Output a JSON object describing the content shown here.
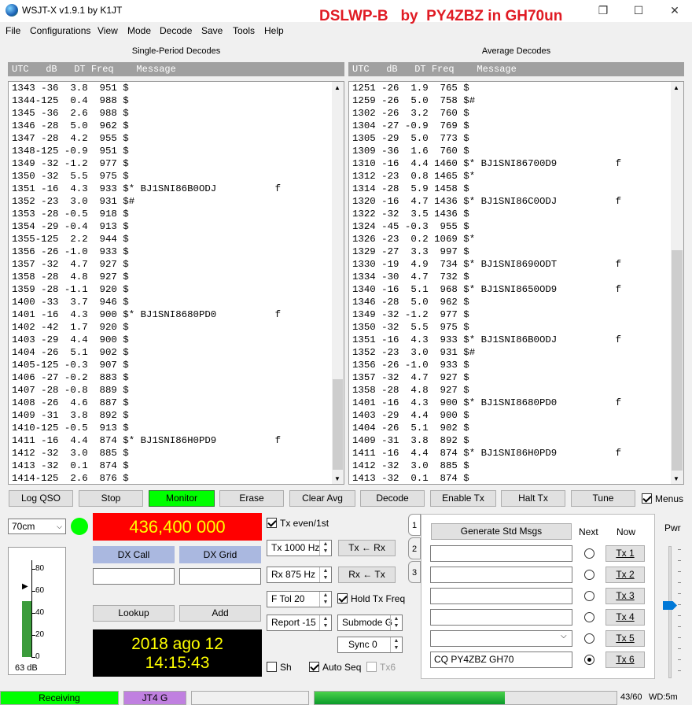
{
  "window": {
    "title": "WSJT-X   v1.9.1   by K1JT",
    "overlay": "DSLWP-B   by  PY4ZBZ in GH70un",
    "min_icon": "minimize-icon",
    "restore_icon": "restore-icon",
    "close_icon": "close-icon"
  },
  "menu": [
    "File",
    "Configurations",
    "View",
    "Mode",
    "Decode",
    "Save",
    "Tools",
    "Help"
  ],
  "left_panel": {
    "caption": "Single-Period Decodes",
    "header": "UTC   dB   DT Freq    Message",
    "lines": [
      "1343 -36  3.8  951 $",
      "1344-125  0.4  988 $",
      "1345 -36  2.6  988 $",
      "1346 -28  5.0  962 $",
      "1347 -28  4.2  955 $",
      "1348-125 -0.9  951 $",
      "1349 -32 -1.2  977 $",
      "1350 -32  5.5  975 $",
      "1351 -16  4.3  933 $* BJ1SNI86B0ODJ          f",
      "1352 -23  3.0  931 $#",
      "1353 -28 -0.5  918 $",
      "1354 -29 -0.4  913 $",
      "1355-125  2.2  944 $",
      "1356 -26 -1.0  933 $",
      "1357 -32  4.7  927 $",
      "1358 -28  4.8  927 $",
      "1359 -28 -1.1  920 $",
      "1400 -33  3.7  946 $",
      "1401 -16  4.3  900 $* BJ1SNI8680PD0          f",
      "1402 -42  1.7  920 $",
      "1403 -29  4.4  900 $",
      "1404 -26  5.1  902 $",
      "1405-125 -0.3  907 $",
      "1406 -27 -0.2  883 $",
      "1407 -28 -0.8  889 $",
      "1408 -26  4.6  887 $",
      "1409 -31  3.8  892 $",
      "1410-125 -0.5  913 $",
      "1411 -16  4.4  874 $* BJ1SNI86H0PD9          f",
      "1412 -32  3.0  885 $",
      "1413 -32  0.1  874 $",
      "1414-125  2.6  876 $"
    ]
  },
  "right_panel": {
    "caption": "Average Decodes",
    "header": "UTC   dB   DT Freq    Message",
    "lines": [
      "1251 -26  1.9  765 $",
      "1259 -26  5.0  758 $#",
      "1302 -26  3.2  760 $",
      "1304 -27 -0.9  769 $",
      "1305 -29  5.0  773 $",
      "1309 -36  1.6  760 $",
      "1310 -16  4.4 1460 $* BJ1SNI86700D9          f",
      "1312 -23  0.8 1465 $*",
      "1314 -28  5.9 1458 $",
      "1320 -16  4.7 1436 $* BJ1SNI86C0ODJ          f",
      "1322 -32  3.5 1436 $",
      "1324 -45 -0.3  955 $",
      "1326 -23  0.2 1069 $*",
      "1329 -27  3.3  997 $",
      "1330 -19  4.9  734 $* BJ1SNI8690ODT          f",
      "1334 -30  4.7  732 $",
      "1340 -16  5.1  968 $* BJ1SNI8650OD9          f",
      "1346 -28  5.0  962 $",
      "1349 -32 -1.2  977 $",
      "1350 -32  5.5  975 $",
      "1351 -16  4.3  933 $* BJ1SNI86B0ODJ          f",
      "1352 -23  3.0  931 $#",
      "1356 -26 -1.0  933 $",
      "1357 -32  4.7  927 $",
      "1358 -28  4.8  927 $",
      "1401 -16  4.3  900 $* BJ1SNI8680PD0          f",
      "1403 -29  4.4  900 $",
      "1404 -26  5.1  902 $",
      "1409 -31  3.8  892 $",
      "1411 -16  4.4  874 $* BJ1SNI86H0PD9          f",
      "1412 -32  3.0  885 $",
      "1413 -32  0.1  874 $"
    ]
  },
  "buttons": {
    "log_qso": "Log QSO",
    "stop": "Stop",
    "monitor": "Monitor",
    "erase": "Erase",
    "clear_avg": "Clear Avg",
    "decode": "Decode",
    "enable_tx": "Enable Tx",
    "halt_tx": "Halt Tx",
    "tune": "Tune",
    "menus": "Menus"
  },
  "band": {
    "selected": "70cm"
  },
  "frequency": "436,400 000",
  "dx": {
    "call_label": "DX Call",
    "grid_label": "DX Grid",
    "lookup": "Lookup",
    "add": "Add",
    "call": "",
    "grid": ""
  },
  "datetime": {
    "date": "2018 ago 12",
    "time": "14:15:43"
  },
  "meter": {
    "db": "63 dB",
    "ticks": [
      "80",
      "60",
      "40",
      "20",
      "0"
    ],
    "level_fraction": 0.51
  },
  "controls": {
    "tx_even": "Tx even/1st",
    "tx_hz": "Tx  1000  Hz",
    "rx_hz": "Rx  875  Hz",
    "tx_from_rx": "Tx ← Rx",
    "rx_from_tx": "Rx ← Tx",
    "ftol": "F Tol  20",
    "hold_tx": "Hold Tx Freq",
    "report": "Report -15",
    "submode": "Submode G",
    "sync": "Sync   0",
    "sh": "Sh",
    "auto_seq": "Auto Seq",
    "tx6_check": "Tx6"
  },
  "tabs": [
    "1",
    "2",
    "3"
  ],
  "std_msgs": {
    "generate": "Generate Std Msgs",
    "next": "Next",
    "now": "Now",
    "messages": [
      "",
      "",
      "",
      "",
      "",
      ""
    ],
    "tx_buttons": [
      "Tx 1",
      "Tx 2",
      "Tx 3",
      "Tx 4",
      "Tx 5",
      "Tx 6"
    ],
    "tx6_message": "CQ PY4ZBZ GH70",
    "selected_index": 5
  },
  "pwr": {
    "label": "Pwr",
    "level_fraction": 0.55
  },
  "status": {
    "receiving": "Receiving",
    "mode": "JT4 G",
    "progress_fraction": 0.63,
    "count": "43/60",
    "wd": "WD:5m"
  },
  "colors": {
    "green": "#00ff00",
    "red_freq": "#ff0000",
    "freq_text": "#ffff00",
    "dx_blue": "#aab8e0",
    "mode_purple": "#c080e0",
    "title_red": "#e01b24"
  }
}
